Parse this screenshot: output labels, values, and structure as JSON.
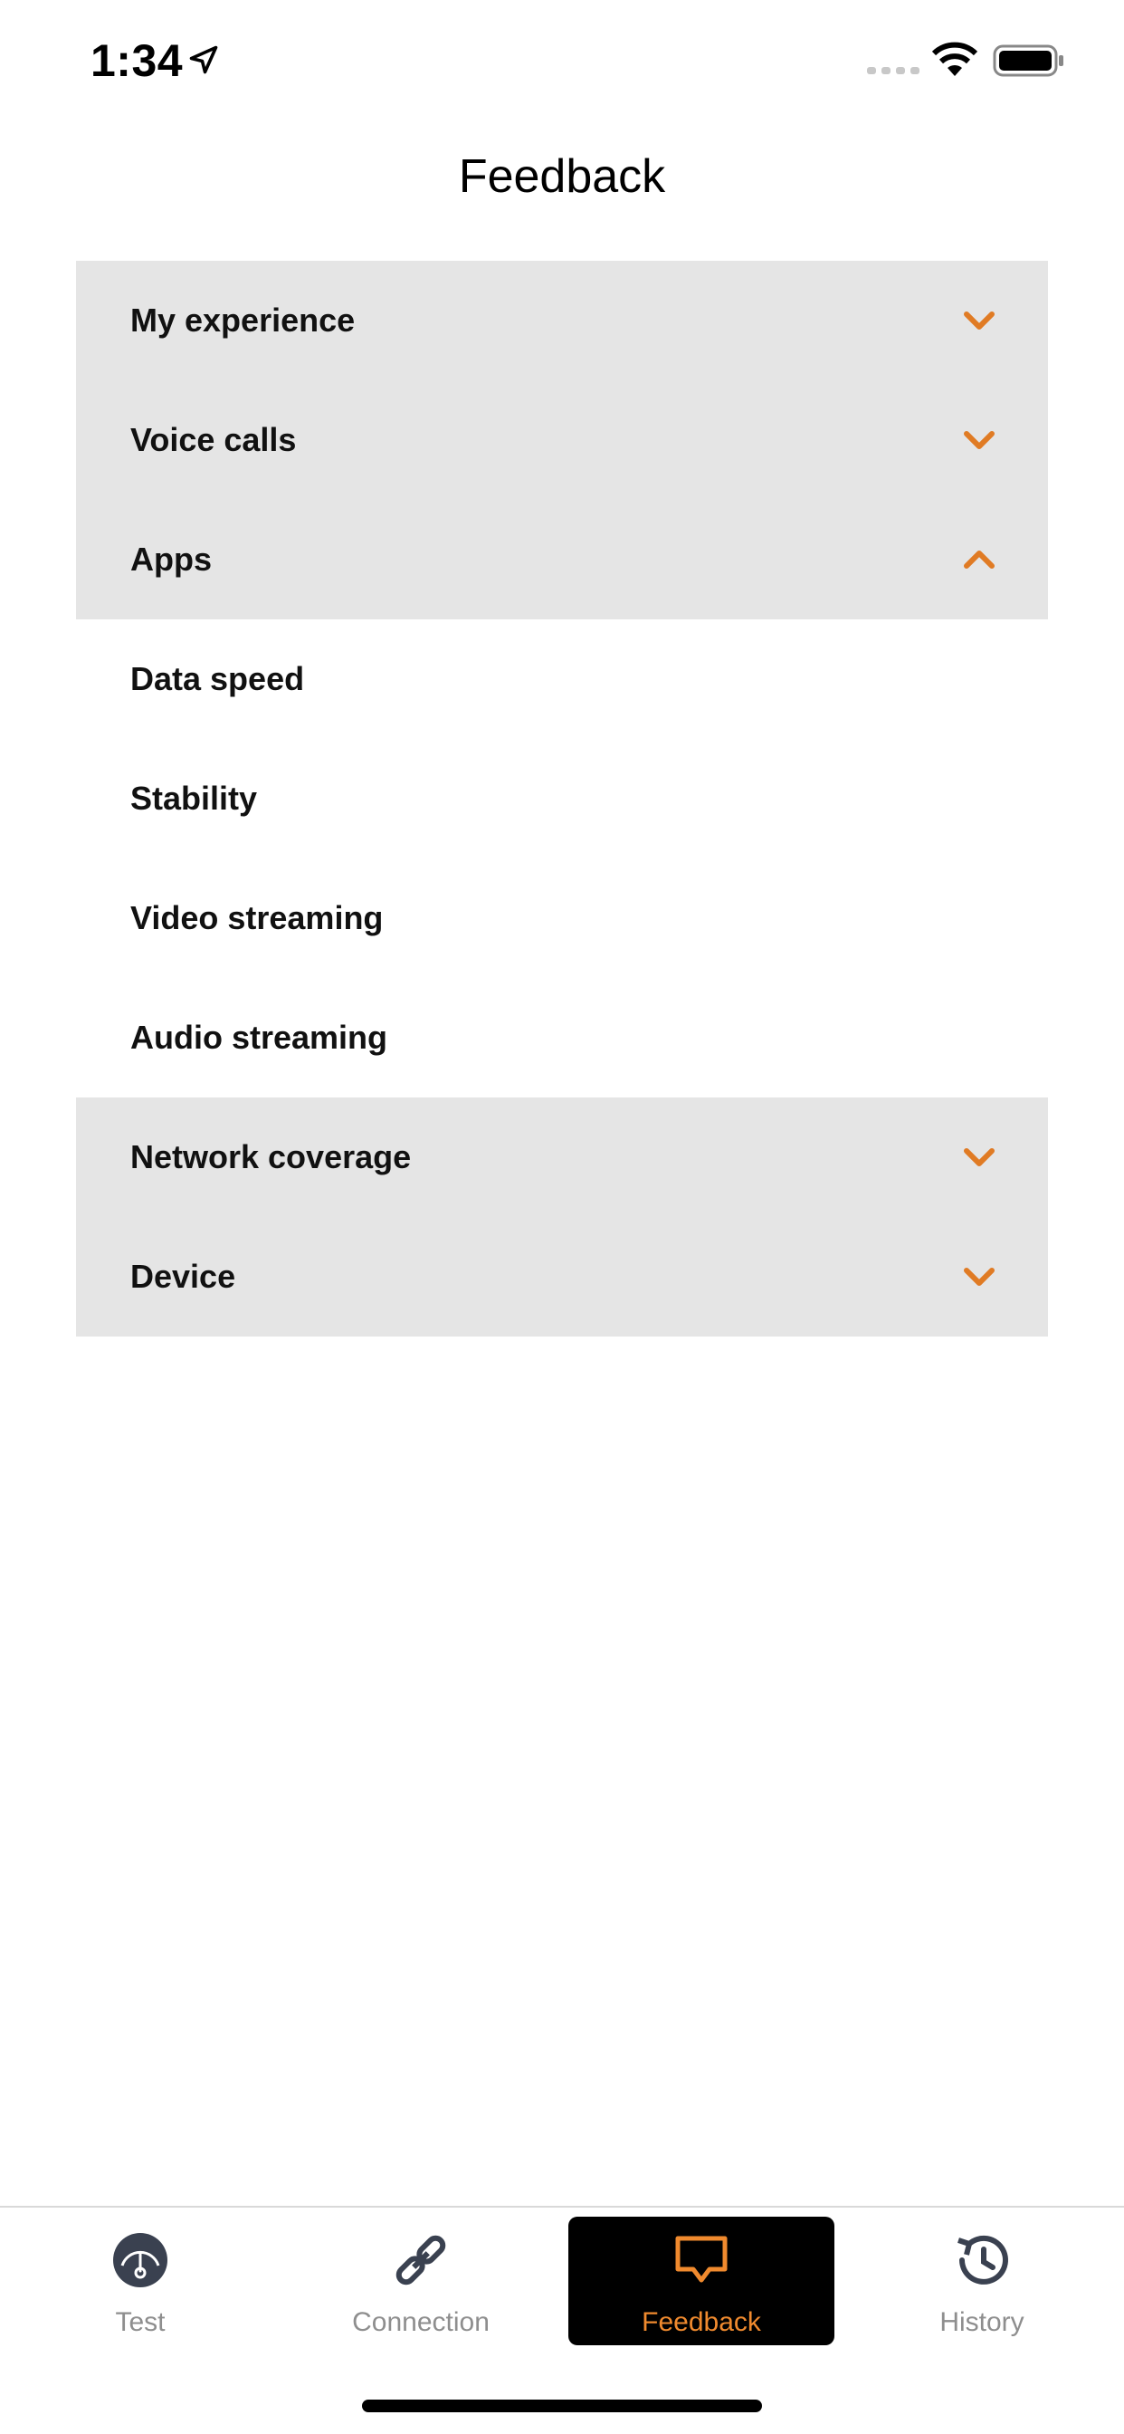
{
  "status_bar": {
    "time": "1:34"
  },
  "header": {
    "title": "Feedback"
  },
  "list": [
    {
      "label": "My experience",
      "type": "section",
      "chevron": "down"
    },
    {
      "label": "Voice calls",
      "type": "section",
      "chevron": "down"
    },
    {
      "label": "Apps",
      "type": "section",
      "chevron": "up"
    },
    {
      "label": "Data speed",
      "type": "sub"
    },
    {
      "label": "Stability",
      "type": "sub"
    },
    {
      "label": "Video streaming",
      "type": "sub"
    },
    {
      "label": "Audio streaming",
      "type": "sub"
    },
    {
      "label": "Network coverage",
      "type": "section",
      "chevron": "down"
    },
    {
      "label": "Device",
      "type": "section",
      "chevron": "down"
    }
  ],
  "tabs": [
    {
      "label": "Test",
      "icon": "gauge-icon",
      "active": false
    },
    {
      "label": "Connection",
      "icon": "link-icon",
      "active": false
    },
    {
      "label": "Feedback",
      "icon": "speech-bubble-icon",
      "active": true
    },
    {
      "label": "History",
      "icon": "history-icon",
      "active": false
    }
  ],
  "colors": {
    "accent": "#e07b24",
    "section_bg": "#e5e5e5",
    "active_tab_bg": "#000000"
  }
}
